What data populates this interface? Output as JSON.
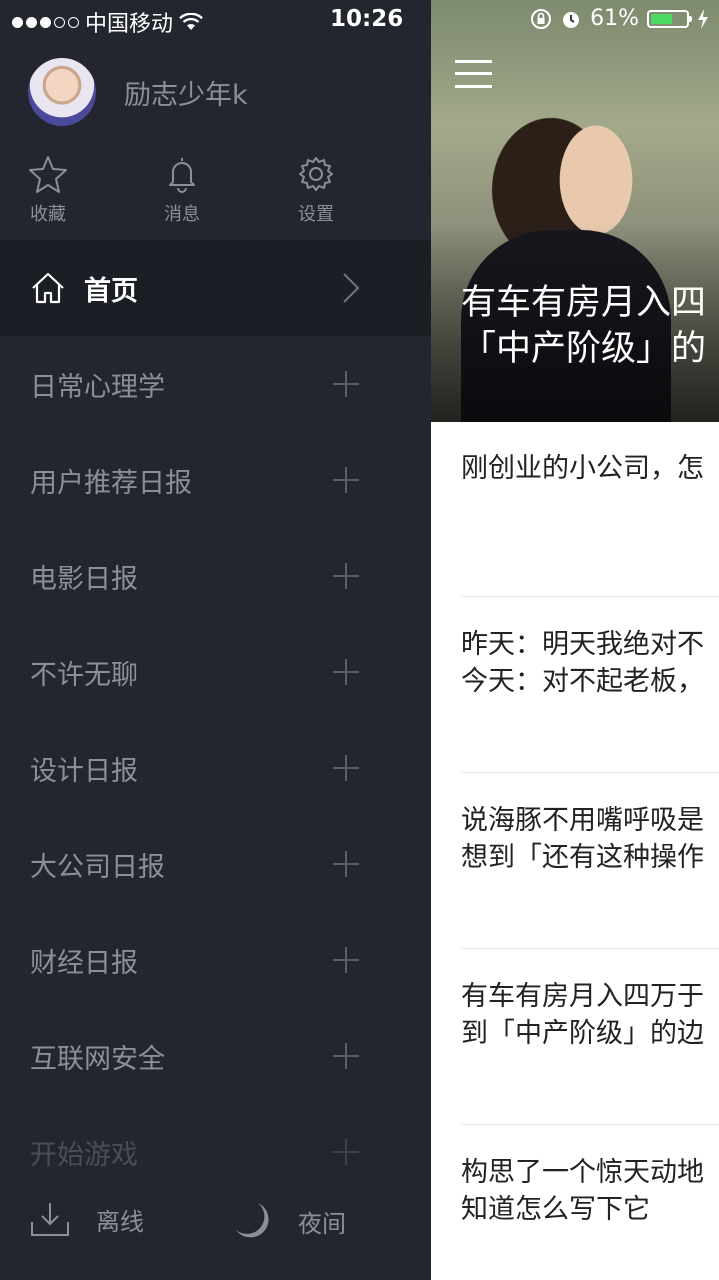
{
  "status_bar": {
    "carrier": "中国移动",
    "time": "10:26",
    "battery": "61%",
    "battery_level": 0.61
  },
  "drawer": {
    "username": "励志少年k",
    "quick_actions": [
      {
        "label": "收藏",
        "icon": "star-icon"
      },
      {
        "label": "消息",
        "icon": "bell-icon"
      },
      {
        "label": "设置",
        "icon": "gear-icon"
      }
    ],
    "home": {
      "label": "首页",
      "icon": "home-icon"
    },
    "menu_items": [
      {
        "label": "日常心理学"
      },
      {
        "label": "用户推荐日报"
      },
      {
        "label": "电影日报"
      },
      {
        "label": "不许无聊"
      },
      {
        "label": "设计日报"
      },
      {
        "label": "大公司日报"
      },
      {
        "label": "财经日报"
      },
      {
        "label": "互联网安全"
      },
      {
        "label": "开始游戏"
      }
    ],
    "bottom": {
      "offline": "离线",
      "night": "夜间"
    }
  },
  "content": {
    "hero_title_line1": "有车有房月入四",
    "hero_title_line2": "「中产阶级」的",
    "news": [
      {
        "line1": "刚创业的小公司，怎",
        "line2": ""
      },
      {
        "line1": "昨天：明天我绝对不",
        "line2": "今天：对不起老板，"
      },
      {
        "line1": "说海豚不用嘴呼吸是",
        "line2": "想到「还有这种操作"
      },
      {
        "line1": "有车有房月入四万于",
        "line2": "到「中产阶级」的边"
      },
      {
        "line1": "构思了一个惊天动地",
        "line2": "知道怎么写下它"
      }
    ]
  }
}
